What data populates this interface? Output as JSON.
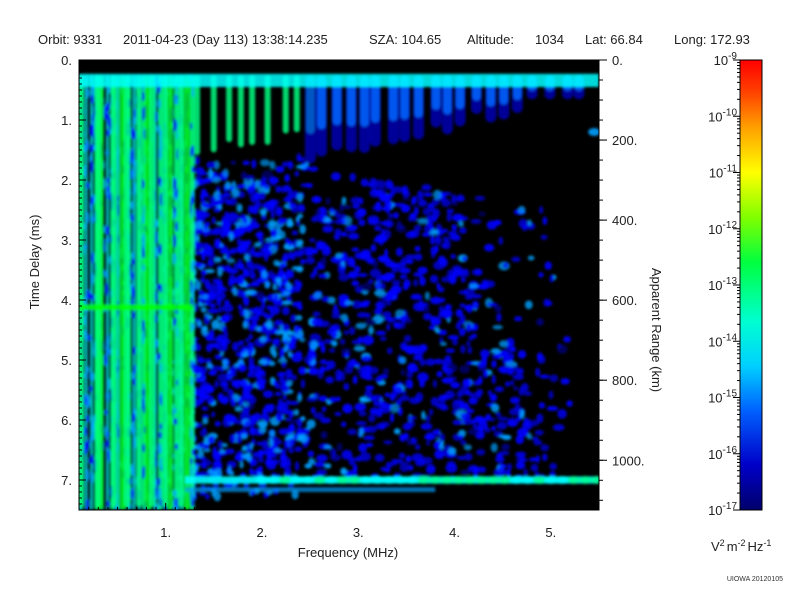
{
  "header": {
    "orbit": "Orbit: 9331",
    "datetime": "2011-04-23 (Day 113) 13:38:14.235",
    "sza": "SZA: 104.65",
    "altitude_label": "Altitude:",
    "altitude_value": "1034",
    "lat": "Lat: 66.84",
    "long": "Long: 172.93"
  },
  "stamp": "UIOWA 20120105",
  "chart_data": {
    "type": "heatmap",
    "xlabel": "Frequency (MHz)",
    "ylabel": "Time Delay (ms)",
    "y2label": "Apparent Range (km)",
    "xlim": [
      0.1,
      5.5
    ],
    "ylim": [
      0,
      7.5
    ],
    "y_inverted": true,
    "x_ticks": [
      "1.",
      "2.",
      "3.",
      "4.",
      "5."
    ],
    "x_tick_values": [
      1,
      2,
      3,
      4,
      5
    ],
    "y_ticks": [
      "0.",
      "1.",
      "2.",
      "3.",
      "4.",
      "5.",
      "6.",
      "7."
    ],
    "y_tick_values": [
      0,
      1,
      2,
      3,
      4,
      5,
      6,
      7
    ],
    "y2_ticks": [
      "0.",
      "200.",
      "400.",
      "600.",
      "800.",
      "1000."
    ],
    "y2_tick_values": [
      0,
      200,
      400,
      600,
      800,
      1000
    ],
    "y2_ms_per_km": 0.006671,
    "colorbar": {
      "scale": "log",
      "range": [
        1e-17,
        1e-09
      ],
      "tick_bases": [
        "10",
        "10",
        "10",
        "10",
        "10",
        "10",
        "10",
        "10",
        "10"
      ],
      "tick_exponents": [
        "-9",
        "-10",
        "-11",
        "-12",
        "-13",
        "-14",
        "-15",
        "-16",
        "-17"
      ],
      "tick_values": [
        -9,
        -10,
        -11,
        -12,
        -13,
        -14,
        -15,
        -16,
        -17
      ],
      "unit_parts": [
        "V",
        "2",
        "m",
        "-2",
        "Hz",
        "-1"
      ],
      "colors": [
        "#000080",
        "#0000ff",
        "#00a0ff",
        "#00ffff",
        "#00ff80",
        "#00ff00",
        "#a0ff00",
        "#ffff00",
        "#ffa000",
        "#ff4000",
        "#ff0000"
      ]
    },
    "features": [
      {
        "name": "vertical plasma lines",
        "freq_range": [
          0.1,
          1.3
        ],
        "delay_range": [
          0.25,
          7.5
        ]
      },
      {
        "name": "surface reflection",
        "delay": 7.0,
        "freq_range": [
          1.2,
          5.5
        ]
      },
      {
        "name": "top band",
        "delay": 0.3,
        "freq_range": [
          0.1,
          5.5
        ]
      },
      {
        "name": "harmonic trace",
        "delay": 4.1,
        "freq_range": [
          0.1,
          1.3
        ]
      }
    ]
  }
}
